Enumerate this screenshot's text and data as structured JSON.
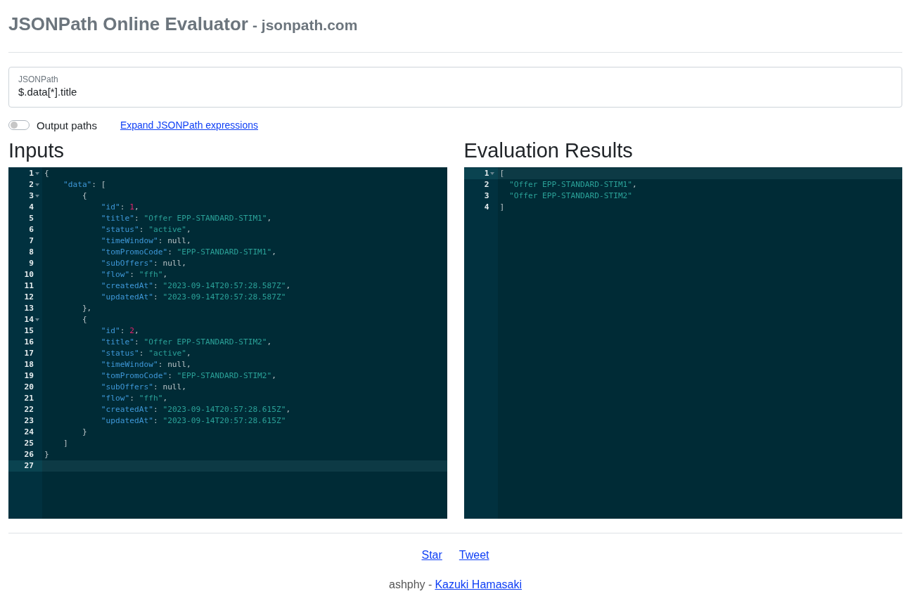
{
  "header": {
    "title": "JSONPath Online Evaluator",
    "subtitle": "- jsonpath.com"
  },
  "query": {
    "label": "JSONPath",
    "value": "$.data[*].title"
  },
  "options": {
    "output_paths": {
      "label": "Output paths",
      "on": false
    },
    "expand_link": "Expand JSONPath expressions"
  },
  "inputs": {
    "heading": "Inputs",
    "lines": [
      {
        "num": "1",
        "fold": true,
        "active": false,
        "tokens": [
          {
            "kind": "punct",
            "s": "{"
          }
        ]
      },
      {
        "num": "2",
        "fold": true,
        "active": false,
        "tokens": [
          {
            "kind": "key",
            "s": "    \"data\""
          },
          {
            "kind": "punct",
            "s": ": ["
          }
        ]
      },
      {
        "num": "3",
        "fold": true,
        "active": false,
        "tokens": [
          {
            "kind": "punct",
            "s": "        {"
          }
        ]
      },
      {
        "num": "4",
        "fold": false,
        "active": false,
        "tokens": [
          {
            "kind": "key",
            "s": "            \"id\""
          },
          {
            "kind": "punct",
            "s": ": "
          },
          {
            "kind": "number",
            "s": "1"
          },
          {
            "kind": "punct",
            "s": ","
          }
        ]
      },
      {
        "num": "5",
        "fold": false,
        "active": false,
        "tokens": [
          {
            "kind": "key",
            "s": "            \"title\""
          },
          {
            "kind": "punct",
            "s": ": "
          },
          {
            "kind": "string",
            "s": "\"Offer EPP-STANDARD-STIM1\""
          },
          {
            "kind": "punct",
            "s": ","
          }
        ]
      },
      {
        "num": "6",
        "fold": false,
        "active": false,
        "tokens": [
          {
            "kind": "key",
            "s": "            \"status\""
          },
          {
            "kind": "punct",
            "s": ": "
          },
          {
            "kind": "string",
            "s": "\"active\""
          },
          {
            "kind": "punct",
            "s": ","
          }
        ]
      },
      {
        "num": "7",
        "fold": false,
        "active": false,
        "tokens": [
          {
            "kind": "key",
            "s": "            \"timeWindow\""
          },
          {
            "kind": "punct",
            "s": ": null,"
          }
        ]
      },
      {
        "num": "8",
        "fold": false,
        "active": false,
        "tokens": [
          {
            "kind": "key",
            "s": "            \"tomPromoCode\""
          },
          {
            "kind": "punct",
            "s": ": "
          },
          {
            "kind": "string",
            "s": "\"EPP-STANDARD-STIM1\""
          },
          {
            "kind": "punct",
            "s": ","
          }
        ]
      },
      {
        "num": "9",
        "fold": false,
        "active": false,
        "tokens": [
          {
            "kind": "key",
            "s": "            \"subOffers\""
          },
          {
            "kind": "punct",
            "s": ": null,"
          }
        ]
      },
      {
        "num": "10",
        "fold": false,
        "active": false,
        "tokens": [
          {
            "kind": "key",
            "s": "            \"flow\""
          },
          {
            "kind": "punct",
            "s": ": "
          },
          {
            "kind": "string",
            "s": "\"ffh\""
          },
          {
            "kind": "punct",
            "s": ","
          }
        ]
      },
      {
        "num": "11",
        "fold": false,
        "active": false,
        "tokens": [
          {
            "kind": "key",
            "s": "            \"createdAt\""
          },
          {
            "kind": "punct",
            "s": ": "
          },
          {
            "kind": "string",
            "s": "\"2023-09-14T20:57:28.587Z\""
          },
          {
            "kind": "punct",
            "s": ","
          }
        ]
      },
      {
        "num": "12",
        "fold": false,
        "active": false,
        "tokens": [
          {
            "kind": "key",
            "s": "            \"updatedAt\""
          },
          {
            "kind": "punct",
            "s": ": "
          },
          {
            "kind": "string",
            "s": "\"2023-09-14T20:57:28.587Z\""
          }
        ]
      },
      {
        "num": "13",
        "fold": false,
        "active": false,
        "tokens": [
          {
            "kind": "punct",
            "s": "        },"
          }
        ]
      },
      {
        "num": "14",
        "fold": true,
        "active": false,
        "tokens": [
          {
            "kind": "punct",
            "s": "        {"
          }
        ]
      },
      {
        "num": "15",
        "fold": false,
        "active": false,
        "tokens": [
          {
            "kind": "key",
            "s": "            \"id\""
          },
          {
            "kind": "punct",
            "s": ": "
          },
          {
            "kind": "number",
            "s": "2"
          },
          {
            "kind": "punct",
            "s": ","
          }
        ]
      },
      {
        "num": "16",
        "fold": false,
        "active": false,
        "tokens": [
          {
            "kind": "key",
            "s": "            \"title\""
          },
          {
            "kind": "punct",
            "s": ": "
          },
          {
            "kind": "string",
            "s": "\"Offer EPP-STANDARD-STIM2\""
          },
          {
            "kind": "punct",
            "s": ","
          }
        ]
      },
      {
        "num": "17",
        "fold": false,
        "active": false,
        "tokens": [
          {
            "kind": "key",
            "s": "            \"status\""
          },
          {
            "kind": "punct",
            "s": ": "
          },
          {
            "kind": "string",
            "s": "\"active\""
          },
          {
            "kind": "punct",
            "s": ","
          }
        ]
      },
      {
        "num": "18",
        "fold": false,
        "active": false,
        "tokens": [
          {
            "kind": "key",
            "s": "            \"timeWindow\""
          },
          {
            "kind": "punct",
            "s": ": null,"
          }
        ]
      },
      {
        "num": "19",
        "fold": false,
        "active": false,
        "tokens": [
          {
            "kind": "key",
            "s": "            \"tomPromoCode\""
          },
          {
            "kind": "punct",
            "s": ": "
          },
          {
            "kind": "string",
            "s": "\"EPP-STANDARD-STIM2\""
          },
          {
            "kind": "punct",
            "s": ","
          }
        ]
      },
      {
        "num": "20",
        "fold": false,
        "active": false,
        "tokens": [
          {
            "kind": "key",
            "s": "            \"subOffers\""
          },
          {
            "kind": "punct",
            "s": ": null,"
          }
        ]
      },
      {
        "num": "21",
        "fold": false,
        "active": false,
        "tokens": [
          {
            "kind": "key",
            "s": "            \"flow\""
          },
          {
            "kind": "punct",
            "s": ": "
          },
          {
            "kind": "string",
            "s": "\"ffh\""
          },
          {
            "kind": "punct",
            "s": ","
          }
        ]
      },
      {
        "num": "22",
        "fold": false,
        "active": false,
        "tokens": [
          {
            "kind": "key",
            "s": "            \"createdAt\""
          },
          {
            "kind": "punct",
            "s": ": "
          },
          {
            "kind": "string",
            "s": "\"2023-09-14T20:57:28.615Z\""
          },
          {
            "kind": "punct",
            "s": ","
          }
        ]
      },
      {
        "num": "23",
        "fold": false,
        "active": false,
        "tokens": [
          {
            "kind": "key",
            "s": "            \"updatedAt\""
          },
          {
            "kind": "punct",
            "s": ": "
          },
          {
            "kind": "string",
            "s": "\"2023-09-14T20:57:28.615Z\""
          }
        ]
      },
      {
        "num": "24",
        "fold": false,
        "active": false,
        "tokens": [
          {
            "kind": "punct",
            "s": "        }"
          }
        ]
      },
      {
        "num": "25",
        "fold": false,
        "active": false,
        "tokens": [
          {
            "kind": "punct",
            "s": "    ]"
          }
        ]
      },
      {
        "num": "26",
        "fold": false,
        "active": false,
        "tokens": [
          {
            "kind": "punct",
            "s": "}"
          }
        ]
      },
      {
        "num": "27",
        "fold": false,
        "active": true
      }
    ]
  },
  "results": {
    "heading": "Evaluation Results",
    "lines": [
      {
        "num": "1",
        "fold": true,
        "active": true,
        "tokens": [
          {
            "kind": "punct",
            "s": "["
          }
        ]
      },
      {
        "num": "2",
        "fold": false,
        "active": false,
        "tokens": [
          {
            "kind": "string",
            "s": "  \"Offer EPP-STANDARD-STIM1\""
          },
          {
            "kind": "punct",
            "s": ","
          }
        ]
      },
      {
        "num": "3",
        "fold": false,
        "active": false,
        "tokens": [
          {
            "kind": "string",
            "s": "  \"Offer EPP-STANDARD-STIM2\""
          }
        ]
      },
      {
        "num": "4",
        "fold": false,
        "active": false,
        "tokens": [
          {
            "kind": "punct",
            "s": "]"
          }
        ]
      }
    ]
  },
  "footer": {
    "links": [
      "Star",
      "Tweet"
    ],
    "author": "ashphy -",
    "author_link": "Kazuki Hamasaki"
  }
}
